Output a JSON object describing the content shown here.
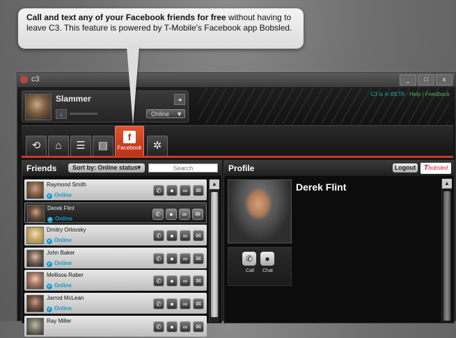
{
  "callout": {
    "bold": "Call and text any of your Facebook friends for free",
    "rest": " without having to leave C3. This feature is powered by T-Mobile's Facebook app Bobsled."
  },
  "window": {
    "title": "c3",
    "minimize": "_",
    "maximize": "□",
    "close": "x"
  },
  "user": {
    "name": "Slammer",
    "status": "Online",
    "beta": "C3 is in BETA",
    "links": "· Help | Feedback"
  },
  "tabs": [
    {
      "icon": "link-icon",
      "glyph": "⟲"
    },
    {
      "icon": "home-icon",
      "glyph": "⌂"
    },
    {
      "icon": "list-icon",
      "glyph": "☰"
    },
    {
      "icon": "contacts-icon",
      "glyph": "▤"
    },
    {
      "icon": "facebook-icon",
      "glyph": "f",
      "label": "Facebook",
      "active": true
    },
    {
      "icon": "settings-icon",
      "glyph": "✲"
    }
  ],
  "friends": {
    "title": "Friends",
    "sort": "Sort by: Online status",
    "search_placeholder": "Search",
    "items": [
      {
        "name": "Raymond Smith",
        "status": "Online"
      },
      {
        "name": "Derek Flint",
        "status": "Online"
      },
      {
        "name": "Dmitry Orlovsky",
        "status": "Online"
      },
      {
        "name": "John Baker",
        "status": "Online"
      },
      {
        "name": "Mellissa Raber",
        "status": "Online"
      },
      {
        "name": "Jarrod McLean",
        "status": "Online"
      },
      {
        "name": "Ray Miller",
        "status": ""
      }
    ]
  },
  "profile": {
    "title": "Profile",
    "logout": "Logout",
    "brand": "bobsled",
    "name": "Derek Flint",
    "call_label": "Call",
    "chat_label": "Chat"
  },
  "colors": {
    "accent": "#c2401e",
    "online": "#1a9ac8"
  }
}
